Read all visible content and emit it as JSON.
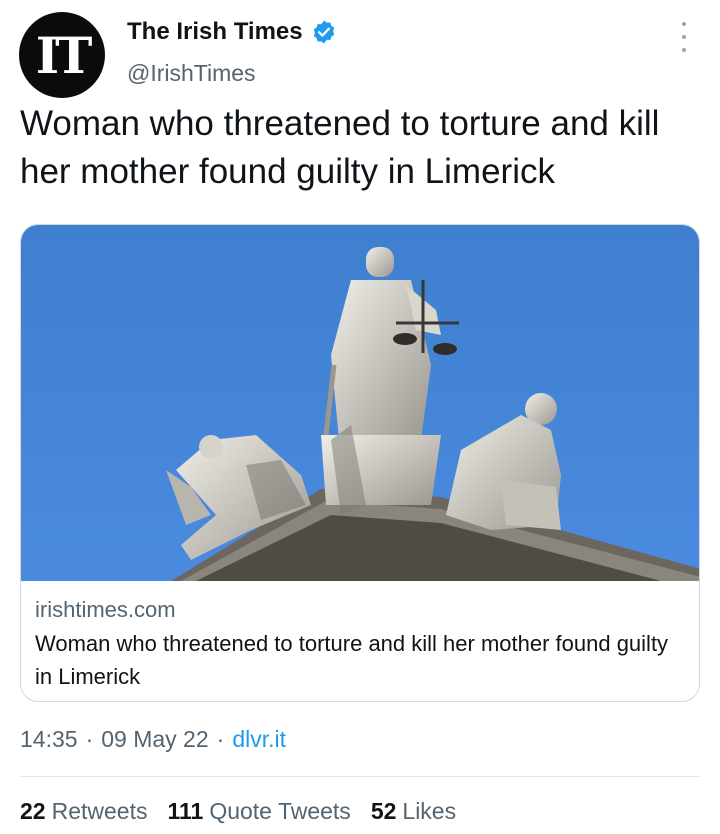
{
  "account": {
    "avatar_text": "IT",
    "display_name": "The Irish Times",
    "handle": "@IrishTimes",
    "verified_color": "#1d9bf0"
  },
  "tweet": {
    "text": "Woman who threatened to torture and kill her mother found guilty in Limerick"
  },
  "card": {
    "image": "statues-justice-courthouse-roof",
    "domain": "irishtimes.com",
    "title": "Woman who threatened to torture and kill her mother found guilty in Limerick"
  },
  "meta": {
    "time": "14:35",
    "sep1": "·",
    "date": "09 May 22",
    "sep2": "·",
    "source": "dlvr.it"
  },
  "stats": {
    "retweets_count": "22",
    "retweets_label": "Retweets",
    "quotes_count": "111",
    "quotes_label": "Quote Tweets",
    "likes_count": "52",
    "likes_label": "Likes"
  }
}
